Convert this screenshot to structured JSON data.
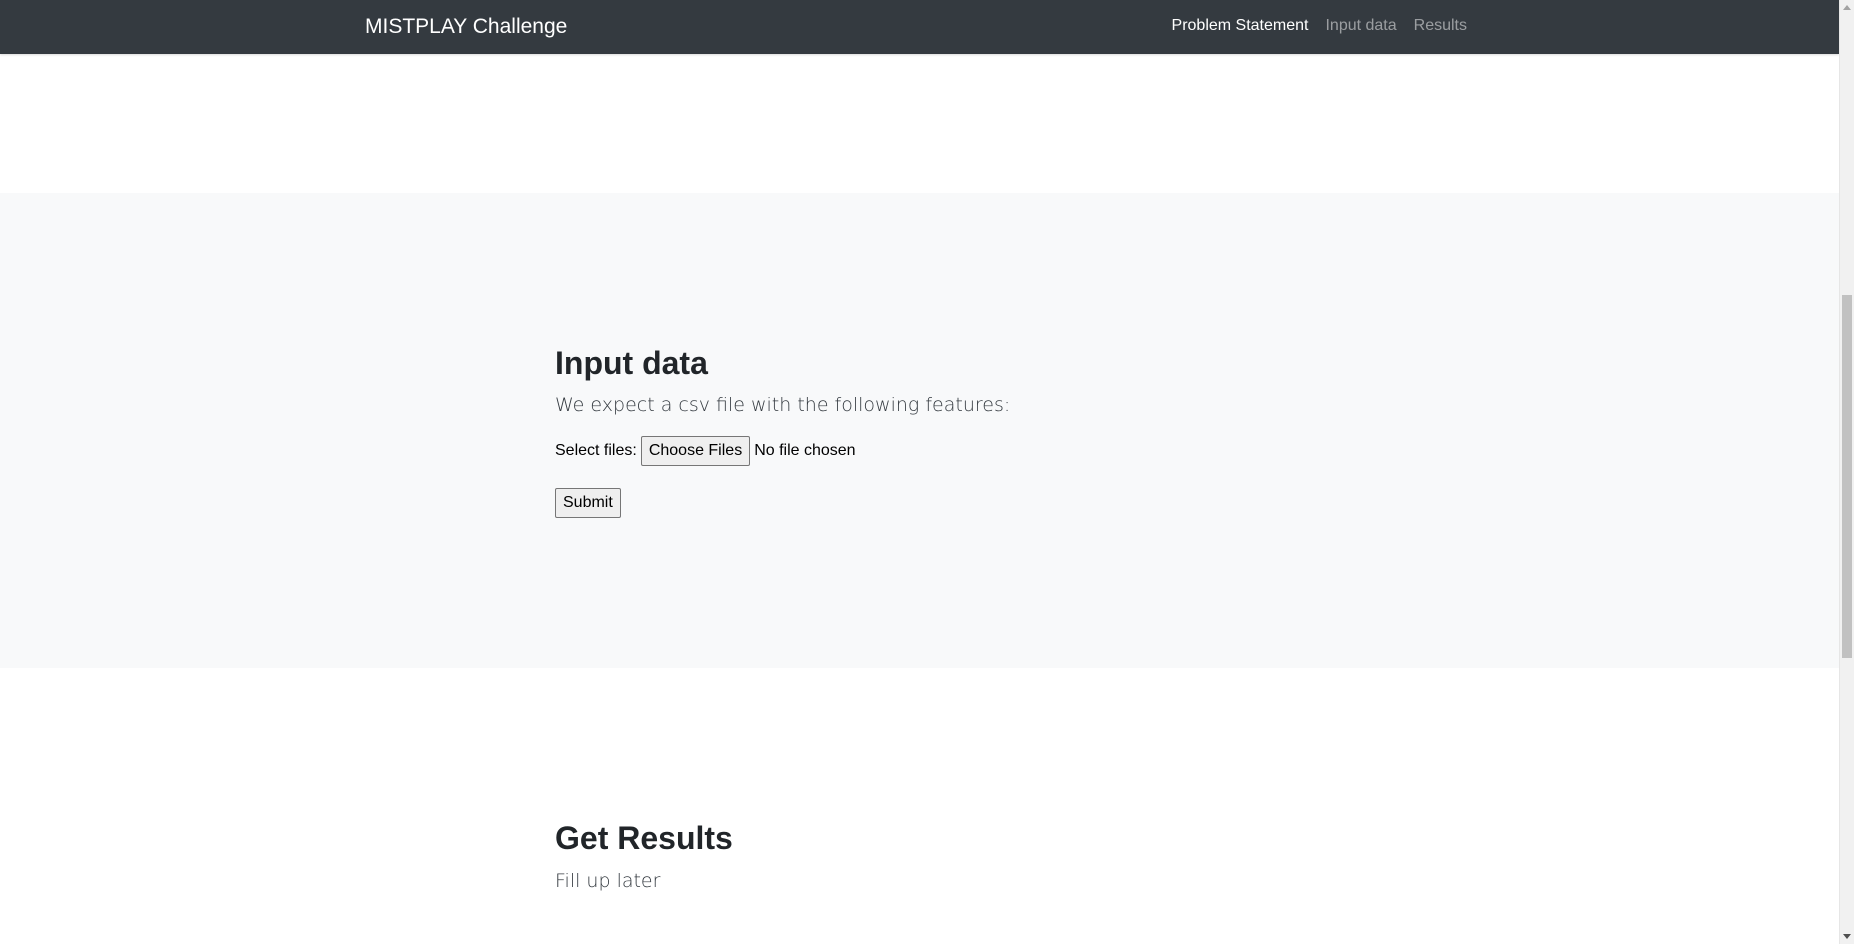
{
  "navbar": {
    "brand": "MISTPLAY Challenge",
    "links": [
      {
        "label": "Problem Statement",
        "active": true
      },
      {
        "label": "Input data",
        "active": false
      },
      {
        "label": "Results",
        "active": false
      }
    ]
  },
  "input_section": {
    "title": "Input data",
    "description": "We expect a csv file with the following features:",
    "file_label": "Select files:",
    "choose_button": "Choose Files",
    "file_status": "No file chosen",
    "submit_label": "Submit"
  },
  "results_section": {
    "title": "Get Results",
    "description": "Fill up later"
  },
  "colors": {
    "navbar_bg": "#343a40",
    "section_alt_bg": "#f8f9fa",
    "text": "#212529"
  }
}
